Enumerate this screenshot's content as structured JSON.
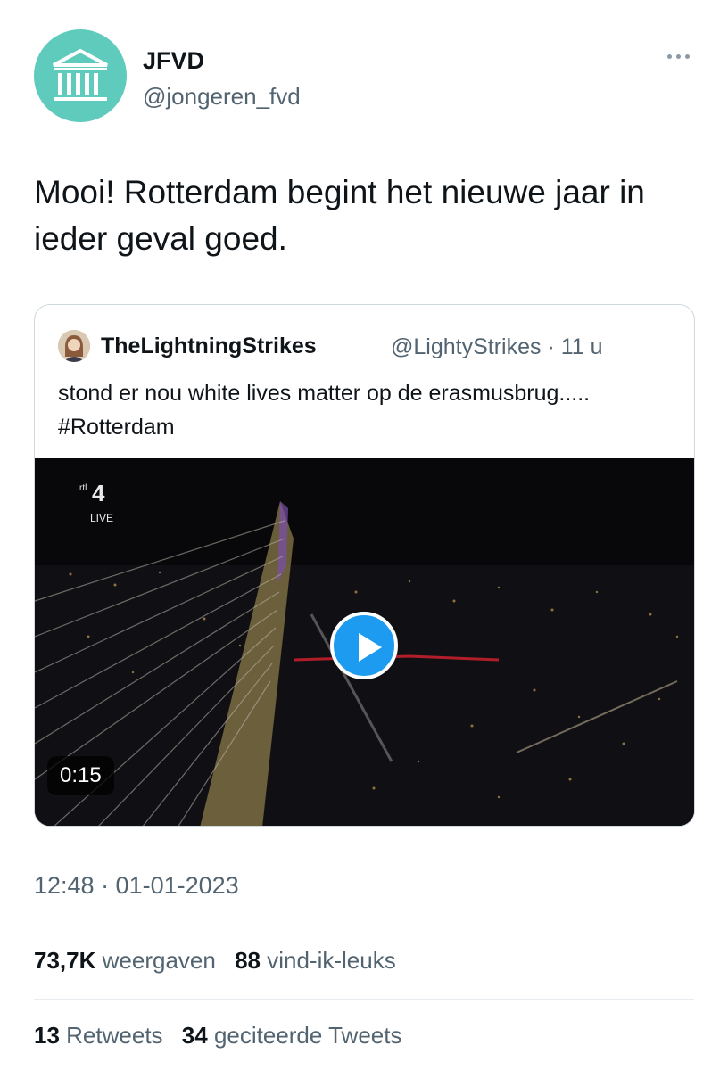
{
  "author": {
    "name": "JFVD",
    "handle": "@jongeren_fvd",
    "avatar_color": "#5ecbbd"
  },
  "tweet": {
    "text": "Mooi! Rotterdam begint het nieuwe jaar in ieder geval goed."
  },
  "quoted_tweet": {
    "name": "TheLightningStrikes",
    "handle_time": "@LightyStrikes · 11 u",
    "text": "stond er nou white lives matter op de erasmusbrug..... #Rotterdam",
    "video": {
      "channel_logo_small": "rtl",
      "channel_logo_number": "4",
      "channel_live": "LIVE",
      "duration": "0:15",
      "play_icon": "play-icon"
    }
  },
  "timestamp": "12:48 · 01-01-2023",
  "stats_row1": [
    {
      "count": "73,7K",
      "label": "weergaven"
    },
    {
      "count": "88",
      "label": "vind-ik-leuks"
    }
  ],
  "stats_row2": [
    {
      "count": "13",
      "label": "Retweets"
    },
    {
      "count": "34",
      "label": "geciteerde Tweets"
    }
  ],
  "colors": {
    "accent": "#1d9bf0",
    "text": "#0f1419",
    "secondary": "#536471",
    "border": "#cfd9de"
  }
}
